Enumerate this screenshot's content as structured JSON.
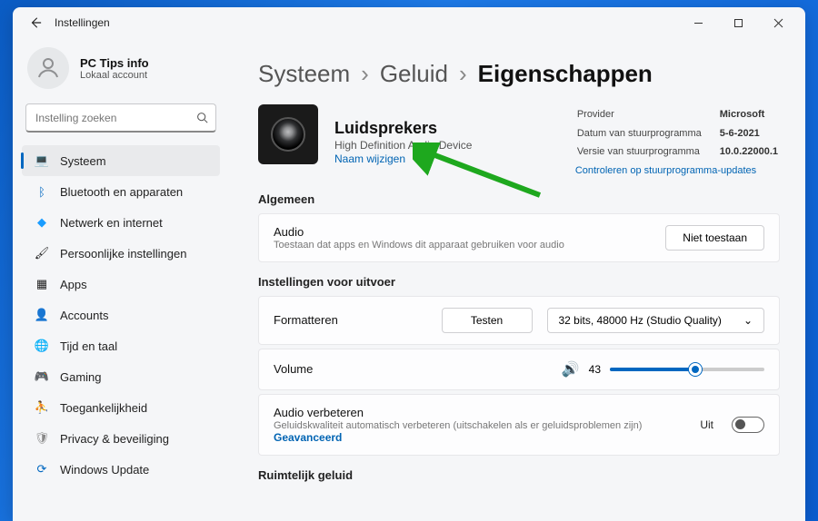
{
  "window": {
    "title": "Instellingen"
  },
  "profile": {
    "name": "PC Tips info",
    "account": "Lokaal account"
  },
  "search": {
    "placeholder": "Instelling zoeken"
  },
  "sidebar": {
    "items": [
      {
        "label": "Systeem"
      },
      {
        "label": "Bluetooth en apparaten"
      },
      {
        "label": "Netwerk en internet"
      },
      {
        "label": "Persoonlijke instellingen"
      },
      {
        "label": "Apps"
      },
      {
        "label": "Accounts"
      },
      {
        "label": "Tijd en taal"
      },
      {
        "label": "Gaming"
      },
      {
        "label": "Toegankelijkheid"
      },
      {
        "label": "Privacy & beveiliging"
      },
      {
        "label": "Windows Update"
      }
    ]
  },
  "breadcrumb": {
    "a": "Systeem",
    "b": "Geluid",
    "c": "Eigenschappen"
  },
  "device": {
    "name": "Luidsprekers",
    "sub": "High Definition Audio Device",
    "rename": "Naam wijzigen",
    "provider_label": "Provider",
    "provider_value": "Microsoft",
    "driver_date_label": "Datum van stuurprogramma",
    "driver_date_value": "5-6-2021",
    "driver_ver_label": "Versie van stuurprogramma",
    "driver_ver_value": "10.0.22000.1",
    "check_updates": "Controleren op stuurprogramma-updates"
  },
  "general": {
    "heading": "Algemeen",
    "audio_title": "Audio",
    "audio_sub": "Toestaan dat apps en Windows dit apparaat gebruiken voor audio",
    "disallow": "Niet toestaan"
  },
  "output": {
    "heading": "Instellingen voor uitvoer",
    "format_label": "Formatteren",
    "test": "Testen",
    "format_value": "32 bits, 48000 Hz (Studio Quality)",
    "volume_label": "Volume",
    "volume_value": "43",
    "enhance_title": "Audio verbeteren",
    "enhance_sub": "Geluidskwaliteit automatisch verbeteren (uitschakelen als er geluidsproblemen zijn)",
    "advanced": "Geavanceerd",
    "off": "Uit"
  },
  "spatial": {
    "heading": "Ruimtelijk geluid"
  }
}
